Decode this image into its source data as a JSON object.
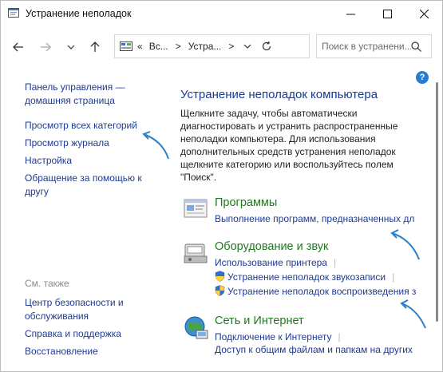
{
  "window": {
    "title": "Устранение неполадок",
    "controls": {
      "minimize": "—",
      "maximize": "☐",
      "close": "✕"
    }
  },
  "nav": {
    "breadcrumb": [
      "«",
      "Вс...",
      ">",
      "Устра...",
      ">"
    ],
    "search_placeholder": "Поиск в устранени..."
  },
  "sidebar": {
    "home_line1": "Панель управления —",
    "home_line2": "домашняя страница",
    "items": [
      "Просмотр всех категорий",
      "Просмотр журнала",
      "Настройка"
    ],
    "help_line1": "Обращение за помощью к",
    "help_line2": "другу",
    "see_also": "См. также",
    "see_also_items": [
      [
        "Центр безопасности и",
        "обслуживания"
      ],
      [
        "Справка и поддержка"
      ],
      [
        "Восстановление"
      ]
    ]
  },
  "main": {
    "help_glyph": "?",
    "title": "Устранение неполадок компьютера",
    "description": "Щелкните задачу, чтобы автоматически диагностировать и устранить распространенные неполадки компьютера. Для использования дополнительных средств устранения неполадок щелкните категорию или воспользуйтесь полем \"Поиск\".",
    "categories": [
      {
        "title": "Программы",
        "icon": "programs-icon",
        "links": [
          "Выполнение программ, предназначенных дл"
        ]
      },
      {
        "title": "Оборудование и звук",
        "icon": "hardware-sound-icon",
        "links": [
          "Использование принтера",
          "Устранение неполадок звукозаписи",
          "Устранение неполадок воспроизведения з"
        ]
      },
      {
        "title": "Сеть и Интернет",
        "icon": "network-internet-icon",
        "links": [
          "Подключение к Интернету",
          "Доступ к общим файлам и папкам на других"
        ]
      }
    ]
  },
  "colors": {
    "link": "#1f3a93",
    "category": "#1f7a1f",
    "title": "#1a3a8f",
    "annotation_arrow": "#2e7ec9"
  }
}
